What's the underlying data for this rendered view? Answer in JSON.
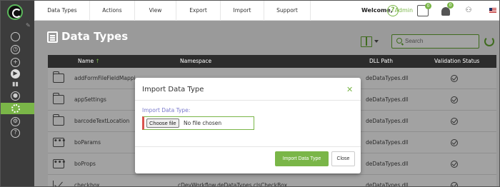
{
  "topbar": {
    "menu": [
      "Data Types",
      "Actions",
      "View",
      "Export",
      "Import",
      "Support"
    ],
    "welcome_label": "Welcome,",
    "user_name": "Admin",
    "help_icon": "?",
    "notif_badge_1": "0",
    "notif_badge_2": "0"
  },
  "page": {
    "title": "Data Types",
    "search_placeholder": "Search"
  },
  "table": {
    "headers": {
      "name": "Name",
      "sort_arrow": "↑",
      "namespace": "Namespace",
      "dll": "DLL Path",
      "validation": "Validation Status"
    },
    "rows": [
      {
        "name": "addFormFileFieldMappin",
        "namespace": "",
        "dll": "deDataTypes.dll",
        "icon": "folder-icon"
      },
      {
        "name": "appSettings",
        "namespace": "",
        "dll": "deDataTypes.dll",
        "icon": "folder-icon"
      },
      {
        "name": "barcodeTextLocation",
        "namespace": "",
        "dll": "deDataTypes.dll",
        "icon": "folder-icon"
      },
      {
        "name": "boParams",
        "namespace": "",
        "dll": "deDataTypes.dll",
        "icon": "dots-icon"
      },
      {
        "name": "boProps",
        "namespace": "",
        "dll": "deDataTypes.dll",
        "icon": "dots-icon"
      },
      {
        "name": "checkbox",
        "namespace": "cDevWorkflow.deDataTypes.clsCheckBox",
        "dll": "deDataTypes.dll",
        "icon": "checkbox-icon"
      }
    ],
    "row_dots": "•••"
  },
  "modal": {
    "title": "Import Data Type",
    "close_glyph": "✕",
    "field_label": "Import Data Type:",
    "choose_file": "Choose file",
    "no_file": "No file chosen",
    "import_button": "Import Data Type",
    "close_button": "Close"
  },
  "colors": {
    "accent": "#7ab648",
    "sidebar": "#3c3c3c",
    "overlay": "#9a9a9a",
    "table_header": "#2c2c2c",
    "error_bar": "#d9534f"
  }
}
